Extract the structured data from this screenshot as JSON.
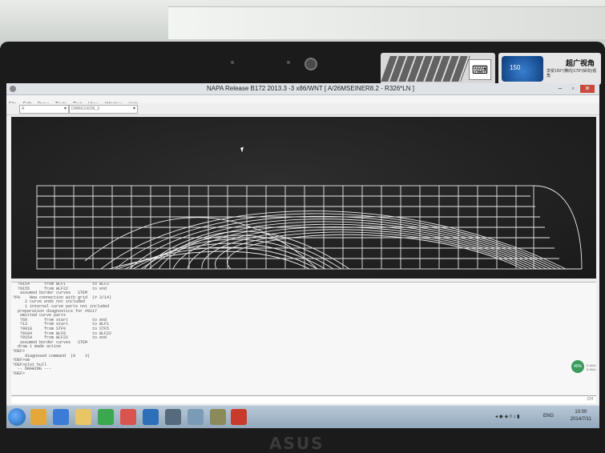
{
  "window": {
    "title": "NAPA Release B172 2013.3 -3 x86/WNT [ A/26MSEINER8.2 - R326*LN ]",
    "minimize_label": "–",
    "maximize_label": "▫",
    "close_label": "✕"
  },
  "menu": {
    "items": [
      "File",
      "Edit",
      "Draw",
      "Tools",
      "Text",
      "View",
      "Window",
      "Help"
    ]
  },
  "toolbar": {
    "combo1_value": "A",
    "combo2_value": "DMR6/16036_3"
  },
  "console": {
    "lines": [
      "  ?9154      from WLF1           to WLF2",
      "  ?9155      from WLF22          to end",
      "   assumed border curves   STEM",
      "?PA    New connection with grid  (# 3/14)",
      "     2 curve ends not included",
      "     1 internal curve parts not included",
      "  preparation diagnostics for #9117",
      "   omitted curve parts",
      "   ?69       from start          to end",
      "   ?13       from start          to WLF1",
      "   ?9018     from STF9           to STF5",
      "   ?9104     from WLF8           to WLF22",
      "   ?9154     from WLF22          to end",
      "   assumed border curves   STEM",
      "  draw 1 made active",
      "?DEF>",
      "     diagnosed command  (0    3)",
      "?DEF>sm",
      "?DEF>plot hull",
      "  -- DRAWING ---",
      "?DEF>"
    ],
    "input_indicator": "CH"
  },
  "network_widget": {
    "percent": "40%",
    "up": "0.1K/s",
    "down": "0.1K/s"
  },
  "taskbar": {
    "language": "ENG",
    "time": "10:00",
    "date": "2014/7/11"
  },
  "stickers": {
    "angle": "150",
    "zh_title": "超广视角",
    "zh_sub": "享受150°(横向)178°(纵向)视角"
  },
  "brand": "ASUS"
}
